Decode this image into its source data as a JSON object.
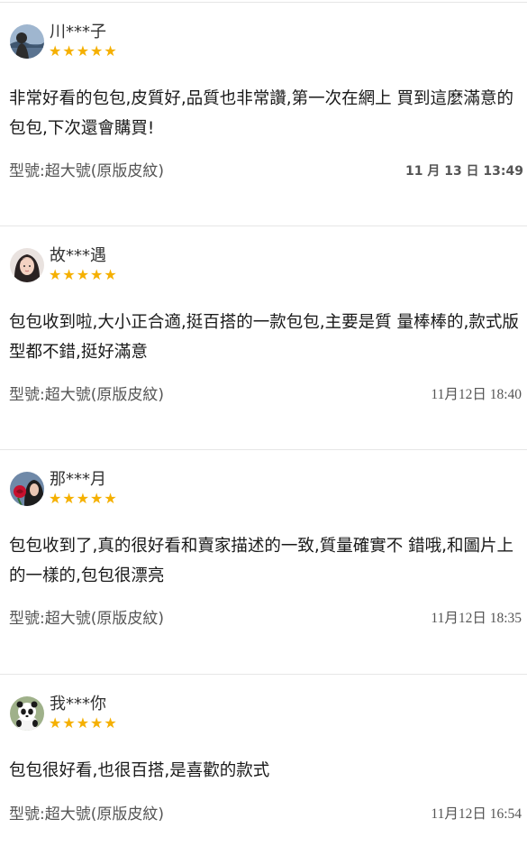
{
  "reviews": [
    {
      "avatar_icon": "avatar-woman-lake",
      "username": "川***子",
      "stars": "★★★★★",
      "content": "非常好看的包包,皮質好,品質也非常讚,第一次在網上 買到這麼滿意的包包,下次還會購買!",
      "model": "型號:超大號(原版皮紋)",
      "date": "11 月 13 日 13:49"
    },
    {
      "avatar_icon": "avatar-girl-portrait",
      "username": "故***遇",
      "stars": "★★★★★",
      "content": "包包收到啦,大小正合適,挺百搭的一款包包,主要是質 量棒棒的,款式版型都不錯,挺好滿意",
      "model": "型號:超大號(原版皮紋)",
      "date": "11月12日 18:40"
    },
    {
      "avatar_icon": "avatar-woman-rose",
      "username": "那***月",
      "stars": "★★★★★",
      "content": "包包收到了,真的很好看和賣家描述的一致,質量確實不 錯哦,和圖片上的一樣的,包包很漂亮",
      "model": "型號:超大號(原版皮紋)",
      "date": "11月12日 18:35"
    },
    {
      "avatar_icon": "avatar-panda",
      "username": "我***你",
      "stars": "★★★★★",
      "content": "包包很好看,也很百搭,是喜歡的款式",
      "model": "型號:超大號(原版皮紋)",
      "date": "11月12日 16:54"
    }
  ],
  "colors": {
    "star": "#f5b000",
    "divider": "#e6e6e6",
    "meta_text": "#555555"
  }
}
